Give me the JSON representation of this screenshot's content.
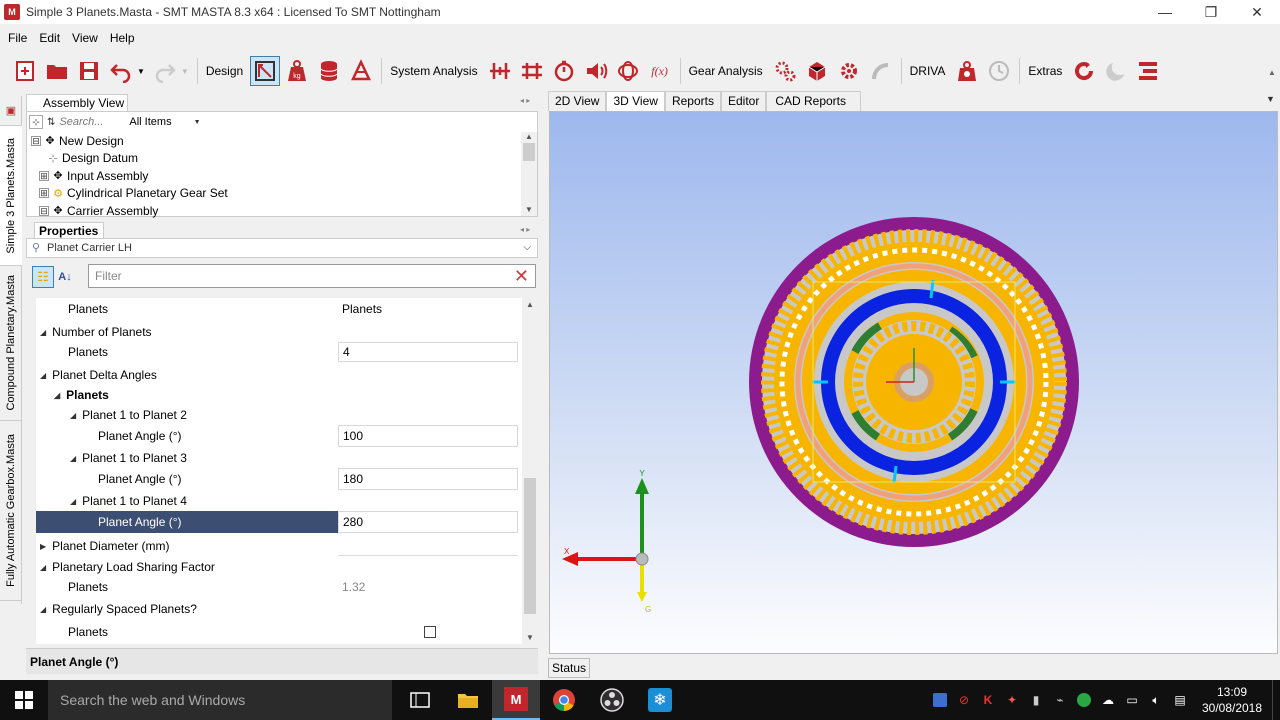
{
  "window": {
    "title": "Simple 3 Planets.Masta - SMT MASTA 8.3 x64 : Licensed To SMT Nottingham",
    "app_icon": "M",
    "minimize": "—",
    "restore": "❐",
    "close": "✕"
  },
  "menu": [
    "File",
    "Edit",
    "View",
    "Help"
  ],
  "toolbar": {
    "design_label": "Design",
    "system_analysis_label": "System Analysis",
    "gear_analysis_label": "Gear Analysis",
    "driva_label": "DRIVA",
    "extras_label": "Extras",
    "fx_label": "f(x)",
    "kg_label": "kg"
  },
  "vertical_tabs": [
    "Simple 3 Planets.Masta",
    "Compound Planetary.Masta",
    "Fully Automatic Gearbox.Masta"
  ],
  "assembly": {
    "tab_label": "Assembly View",
    "search_placeholder": "Search...",
    "filter_value": "All Items",
    "tree": [
      {
        "label": "New Design",
        "icon": "assembly-icon",
        "expander": "⊟"
      },
      {
        "label": "Design Datum",
        "icon": "datum-icon",
        "expander": ""
      },
      {
        "label": "Input Assembly",
        "icon": "assembly-icon",
        "expander": "⊞"
      },
      {
        "label": "Cylindrical Planetary Gear Set",
        "icon": "gear-set-icon",
        "expander": "⊞"
      },
      {
        "label": "Carrier Assembly",
        "icon": "assembly-icon",
        "expander": "⊟"
      }
    ]
  },
  "properties": {
    "tab_label": "Properties",
    "selected_item": "Planet Carrier LH",
    "filter_placeholder": "Filter",
    "header_name": "Planets",
    "header_value": "Planets",
    "rows": {
      "number_of_planets": "Number of Planets",
      "planets_count_label": "Planets",
      "planets_count_value": "4",
      "delta_angles": "Planet Delta Angles",
      "delta_planets": "Planets",
      "p1p2": "Planet 1 to Planet 2",
      "p1p2_label": "Planet Angle (°)",
      "p1p2_value": "100",
      "p1p3": "Planet 1 to Planet 3",
      "p1p3_label": "Planet Angle (°)",
      "p1p3_value": "180",
      "p1p4": "Planet 1 to Planet 4",
      "p1p4_label": "Planet Angle (°)",
      "p1p4_value": "280",
      "planet_diameter": "Planet Diameter (mm)",
      "load_sharing": "Planetary Load Sharing Factor",
      "load_sharing_label": "Planets",
      "load_sharing_value": "1.32",
      "regularly_spaced": "Regularly Spaced Planets?",
      "regularly_spaced_label": "Planets",
      "regularly_spaced_checked": false
    },
    "description_title": "Planet Angle (°)"
  },
  "view_tabs": [
    "2D View",
    "3D View",
    "Reports",
    "Editor",
    "CAD Reports"
  ],
  "active_view_tab": "3D View",
  "axes": {
    "x": "X",
    "y": "Y",
    "z": "G"
  },
  "status_button": "Status",
  "taskbar": {
    "search_placeholder": "Search the web and Windows",
    "time": "13:09",
    "date": "30/08/2018"
  },
  "colors": {
    "ring_outer": "#8c1c8e",
    "gear_yellow": "#f7b500",
    "carrier_blue": "#0a23e0",
    "planet_green": "#2e7d32",
    "selection": "#3d4e73"
  }
}
